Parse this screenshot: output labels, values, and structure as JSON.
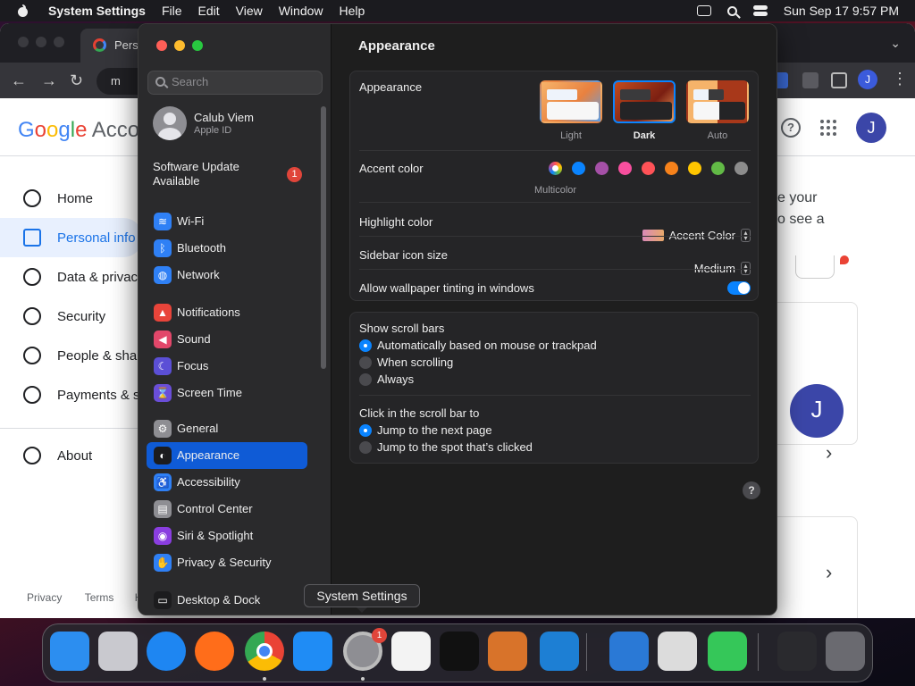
{
  "menubar": {
    "app_name": "System Settings",
    "menus": [
      "File",
      "Edit",
      "View",
      "Window",
      "Help"
    ],
    "clock": "Sun Sep 17  9:57 PM"
  },
  "chrome": {
    "tab_title": "Pers",
    "omnibox_text": "m",
    "avatar_letter": "J",
    "tab_overflow_glyph": "⌄"
  },
  "google": {
    "logo": {
      "G": "G",
      "o1": "o",
      "o2": "o",
      "g": "g",
      "l": "l",
      "e": "e",
      "account": "Accou"
    },
    "nav": [
      {
        "label": "Home",
        "icon": "home-icon"
      },
      {
        "label": "Personal info",
        "icon": "person-card-icon",
        "active": true
      },
      {
        "label": "Data & privac",
        "icon": "toggle-icon"
      },
      {
        "label": "Security",
        "icon": "lock-icon"
      },
      {
        "label": "People & shar",
        "icon": "people-icon"
      },
      {
        "label": "Payments & s",
        "icon": "card-icon"
      }
    ],
    "about": "About",
    "right_text_1": "e your",
    "right_text_2": "o see a",
    "avatar_letter": "J",
    "footer": {
      "privacy": "Privacy",
      "terms": "Terms",
      "help": "H"
    }
  },
  "settings": {
    "search_placeholder": "Search",
    "profile": {
      "name": "Calub Viem",
      "subtitle": "Apple ID"
    },
    "update": {
      "line1": "Software Update",
      "line2": "Available",
      "badge": "1"
    },
    "sidebar_groups": [
      [
        {
          "label": "Wi-Fi",
          "icon": "wifi-icon",
          "color": "#2f80f5",
          "glyph": "≋"
        },
        {
          "label": "Bluetooth",
          "icon": "bluetooth-icon",
          "color": "#2f80f5",
          "glyph": "ᛒ"
        },
        {
          "label": "Network",
          "icon": "globe-icon",
          "color": "#2f80f5",
          "glyph": "◍"
        }
      ],
      [
        {
          "label": "Notifications",
          "icon": "bell-icon",
          "color": "#e8443a",
          "glyph": "▲"
        },
        {
          "label": "Sound",
          "icon": "speaker-icon",
          "color": "#e2476a",
          "glyph": "◀"
        },
        {
          "label": "Focus",
          "icon": "moon-icon",
          "color": "#5b4fd6",
          "glyph": "☾"
        },
        {
          "label": "Screen Time",
          "icon": "hourglass-icon",
          "color": "#6a4ed8",
          "glyph": "⌛"
        }
      ],
      [
        {
          "label": "General",
          "icon": "gear-icon",
          "color": "#8e8e93",
          "glyph": "⚙"
        },
        {
          "label": "Appearance",
          "icon": "appearance-icon",
          "color": "#1c1c1e",
          "glyph": "◐",
          "selected": true
        },
        {
          "label": "Accessibility",
          "icon": "accessibility-icon",
          "color": "#2f80f5",
          "glyph": "♿"
        },
        {
          "label": "Control Center",
          "icon": "control-center-icon",
          "color": "#8e8e93",
          "glyph": "▤"
        },
        {
          "label": "Siri & Spotlight",
          "icon": "siri-icon",
          "color": "#8a3ee0",
          "glyph": "◉"
        },
        {
          "label": "Privacy & Security",
          "icon": "hand-icon",
          "color": "#2f80f5",
          "glyph": "✋"
        }
      ],
      [
        {
          "label": "Desktop & Dock",
          "icon": "dock-icon",
          "color": "#1c1c1e",
          "glyph": "▭"
        }
      ]
    ],
    "title": "Appearance",
    "appearance": {
      "label": "Appearance",
      "options": [
        {
          "label": "Light",
          "selected": false
        },
        {
          "label": "Dark",
          "selected": true
        },
        {
          "label": "Auto",
          "selected": false
        }
      ]
    },
    "accent": {
      "label": "Accent color",
      "colors": [
        "#multicolor",
        "#0a84ff",
        "#a550a7",
        "#f74f9e",
        "#ff5257",
        "#f7821b",
        "#ffc600",
        "#62ba46",
        "#8c8c8c"
      ],
      "caption": "Multicolor"
    },
    "highlight": {
      "label": "Highlight color",
      "value": "Accent Color"
    },
    "sidebar_icon_size": {
      "label": "Sidebar icon size",
      "value": "Medium"
    },
    "wallpaper_tinting": {
      "label": "Allow wallpaper tinting in windows",
      "enabled": true
    },
    "scroll_bars": {
      "label": "Show scroll bars",
      "options": [
        {
          "label": "Automatically based on mouse or trackpad",
          "selected": true
        },
        {
          "label": "When scrolling",
          "selected": false
        },
        {
          "label": "Always",
          "selected": false
        }
      ]
    },
    "click_scroll": {
      "label": "Click in the scroll bar to",
      "options": [
        {
          "label": "Jump to the next page",
          "selected": true
        },
        {
          "label": "Jump to the spot that’s clicked",
          "selected": false
        }
      ]
    },
    "help_glyph": "?"
  },
  "tooltip": "System Settings",
  "dock": {
    "apps": [
      {
        "name": "finder",
        "color": "#2c8ef0",
        "running": false
      },
      {
        "name": "launchpad",
        "color": "#c9c9cf",
        "running": false
      },
      {
        "name": "safari",
        "color": "#1e86f2",
        "running": false
      },
      {
        "name": "firefox",
        "color": "#ff6d1a",
        "running": false
      },
      {
        "name": "chrome",
        "color": "#ffffff",
        "running": true
      },
      {
        "name": "app-store",
        "color": "#1f8cf5",
        "running": false
      },
      {
        "name": "system-settings",
        "color": "#8e8e93",
        "running": true,
        "badge": "1"
      },
      {
        "name": "textedit",
        "color": "#f3f3f3",
        "running": false
      },
      {
        "name": "terminal",
        "color": "#111111",
        "running": false
      },
      {
        "name": "garageband",
        "color": "#d8732a",
        "running": false
      },
      {
        "name": "vscode",
        "color": "#1d7fd4",
        "running": false
      },
      {
        "name": "xcode",
        "color": "#2a79d6",
        "running": false
      },
      {
        "name": "boot-camp",
        "color": "#dcdcdc",
        "running": false
      },
      {
        "name": "facetime",
        "color": "#35c759",
        "running": false
      },
      {
        "name": "downloads",
        "color": "#2a2a2e",
        "running": false
      },
      {
        "name": "trash",
        "color": "#6a6a70",
        "running": false
      }
    ]
  }
}
